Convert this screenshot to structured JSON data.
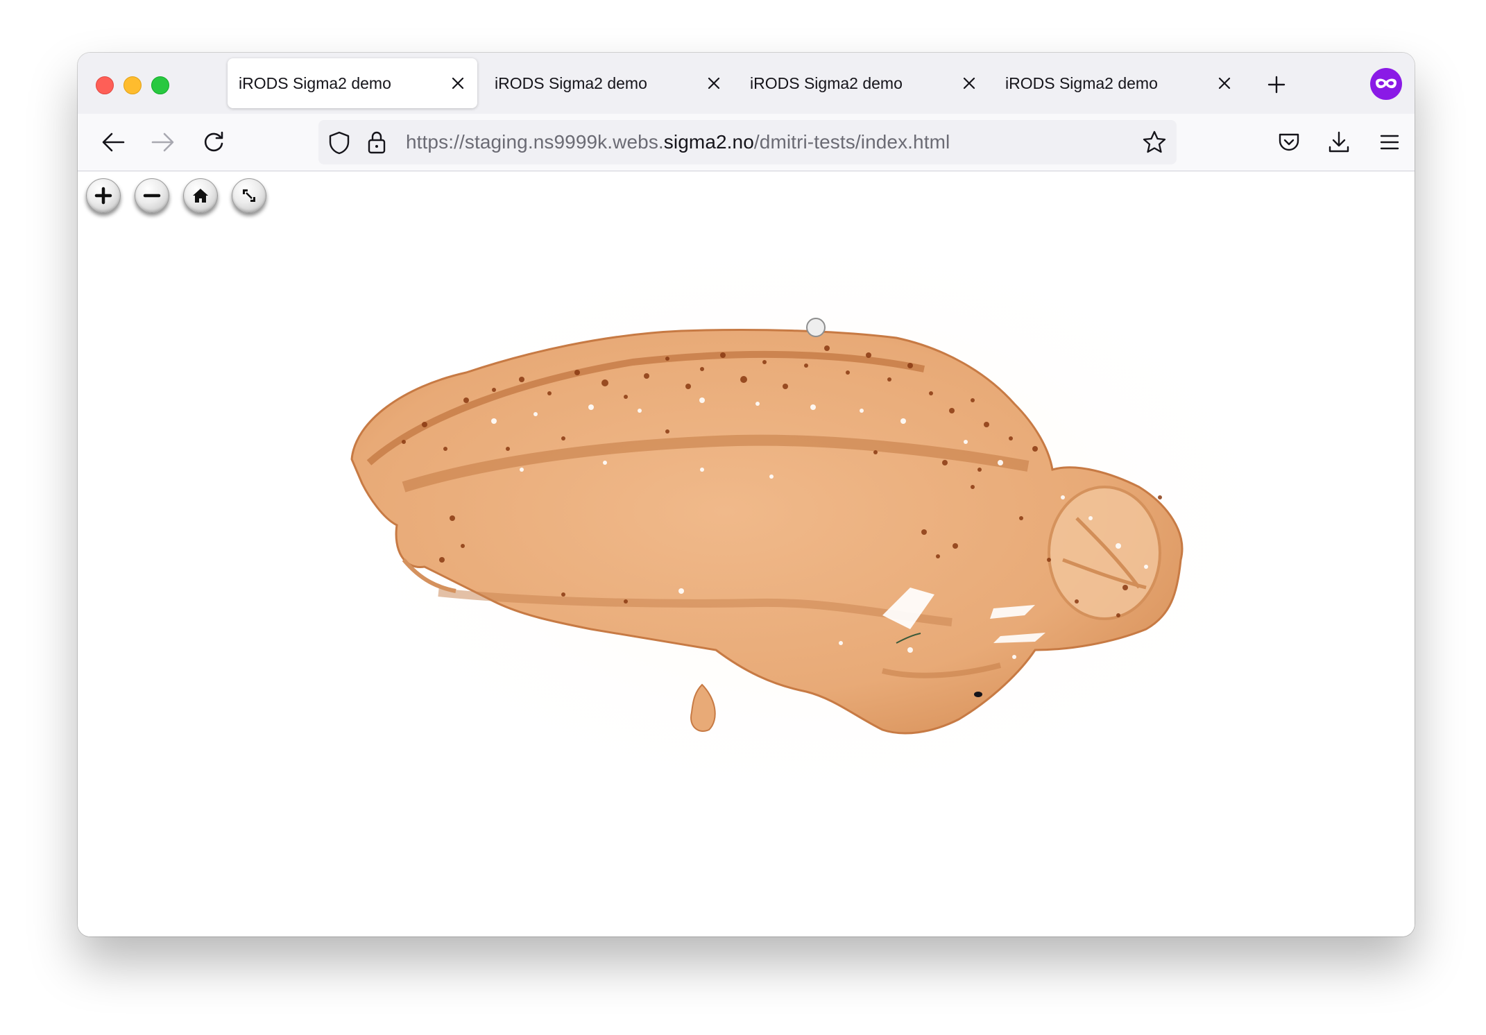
{
  "window": {
    "traffic_lights": [
      "close",
      "minimize",
      "maximize"
    ]
  },
  "tabs": [
    {
      "title": "iRODS Sigma2 demo",
      "active": true
    },
    {
      "title": "iRODS Sigma2 demo",
      "active": false
    },
    {
      "title": "iRODS Sigma2 demo",
      "active": false
    },
    {
      "title": "iRODS Sigma2 demo",
      "active": false
    }
  ],
  "toolbar": {
    "url_prefix": "https://staging.ns9999k.webs.",
    "url_host": "sigma2.no",
    "url_path": "/dmitri-tests/index.html",
    "icons": [
      "back-icon",
      "forward-icon",
      "reload-icon",
      "shield-icon",
      "lock-icon",
      "star-icon",
      "pocket-icon",
      "download-icon",
      "menu-icon"
    ]
  },
  "viewer": {
    "controls": [
      "zoom-in",
      "zoom-out",
      "home",
      "fullscreen"
    ],
    "image_subject": "sagittal brain section, brown stain"
  },
  "colors": {
    "tab_strip": "#f0f0f4",
    "toolbar": "#f9f9fb",
    "private_badge": "#8a1ae6",
    "tissue": "#e8ab7a",
    "stain_dark": "#8a3a12"
  }
}
